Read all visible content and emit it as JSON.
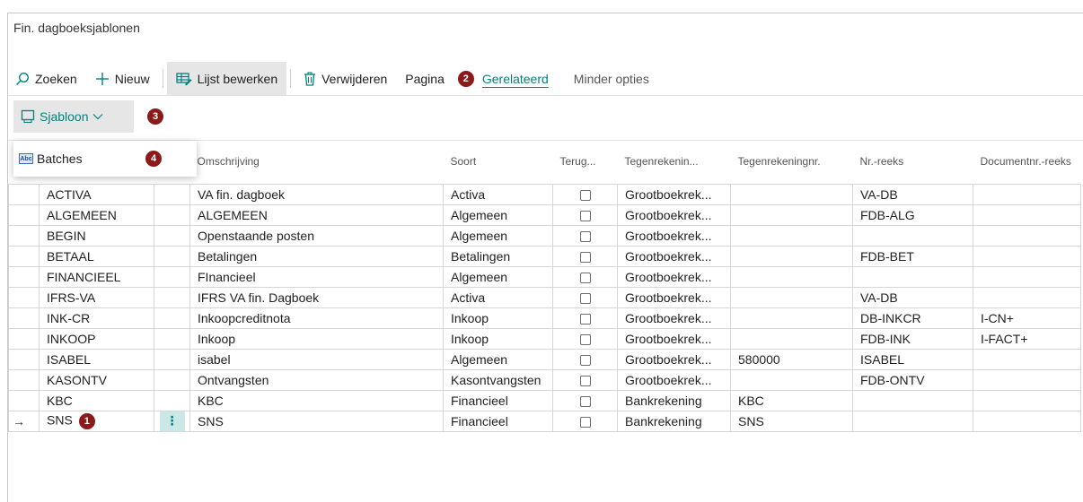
{
  "page": {
    "title": "Fin. dagboeksjablonen"
  },
  "toolbar": {
    "search_label": "Zoeken",
    "new_label": "Nieuw",
    "edit_list_label": "Lijst bewerken",
    "delete_label": "Verwijderen",
    "page_label": "Pagina",
    "related_label": "Gerelateerd",
    "fewer_options_label": "Minder opties"
  },
  "subbar": {
    "template_label": "Sjabloon"
  },
  "dropdown": {
    "batches_label": "Batches",
    "icon_text": "Abc"
  },
  "callouts": {
    "one": "1",
    "two": "2",
    "three": "3",
    "four": "4"
  },
  "table": {
    "headers": {
      "description": "Omschrijving",
      "type": "Soort",
      "recurring": "Terug...",
      "bal_account_type": "Tegenrekenin...",
      "bal_account_no": "Tegenrekeningnr.",
      "no_series": "Nr.-reeks",
      "doc_no_series": "Documentnr.-reeks"
    },
    "rows": [
      {
        "name": "ACTIVA",
        "description": "VA fin. dagboek",
        "type": "Activa",
        "bal_type": "Grootboekrek...",
        "bal_no": "",
        "no_series": "VA-DB",
        "doc_series": ""
      },
      {
        "name": "ALGEMEEN",
        "description": "ALGEMEEN",
        "type": "Algemeen",
        "bal_type": "Grootboekrek...",
        "bal_no": "",
        "no_series": "FDB-ALG",
        "doc_series": ""
      },
      {
        "name": "BEGIN",
        "description": "Openstaande posten",
        "type": "Algemeen",
        "bal_type": "Grootboekrek...",
        "bal_no": "",
        "no_series": "",
        "doc_series": ""
      },
      {
        "name": "BETAAL",
        "description": "Betalingen",
        "type": "Betalingen",
        "bal_type": "Grootboekrek...",
        "bal_no": "",
        "no_series": "FDB-BET",
        "doc_series": ""
      },
      {
        "name": "FINANCIEEL",
        "description": "FInancieel",
        "type": "Algemeen",
        "bal_type": "Grootboekrek...",
        "bal_no": "",
        "no_series": "",
        "doc_series": ""
      },
      {
        "name": "IFRS-VA",
        "description": "IFRS VA fin. Dagboek",
        "type": "Activa",
        "bal_type": "Grootboekrek...",
        "bal_no": "",
        "no_series": "VA-DB",
        "doc_series": ""
      },
      {
        "name": "INK-CR",
        "description": "Inkoopcreditnota",
        "type": "Inkoop",
        "bal_type": "Grootboekrek...",
        "bal_no": "",
        "no_series": "DB-INKCR",
        "doc_series": "I-CN+"
      },
      {
        "name": "INKOOP",
        "description": "Inkoop",
        "type": "Inkoop",
        "bal_type": "Grootboekrek...",
        "bal_no": "",
        "no_series": "FDB-INK",
        "doc_series": "I-FACT+"
      },
      {
        "name": "ISABEL",
        "description": "isabel",
        "type": "Algemeen",
        "bal_type": "Grootboekrek...",
        "bal_no": "580000",
        "no_series": "ISABEL",
        "doc_series": ""
      },
      {
        "name": "KASONTV",
        "description": "Ontvangsten",
        "type": "Kasontvangsten",
        "bal_type": "Grootboekrek...",
        "bal_no": "",
        "no_series": "FDB-ONTV",
        "doc_series": ""
      },
      {
        "name": "KBC",
        "description": "KBC",
        "type": "Financieel",
        "bal_type": "Bankrekening",
        "bal_no": "KBC",
        "no_series": "",
        "doc_series": ""
      },
      {
        "name": "SNS",
        "description": "SNS",
        "type": "Financieel",
        "bal_type": "Bankrekening",
        "bal_no": "SNS",
        "no_series": "",
        "doc_series": ""
      }
    ],
    "row_arrow": "→",
    "dots": "⋮"
  }
}
